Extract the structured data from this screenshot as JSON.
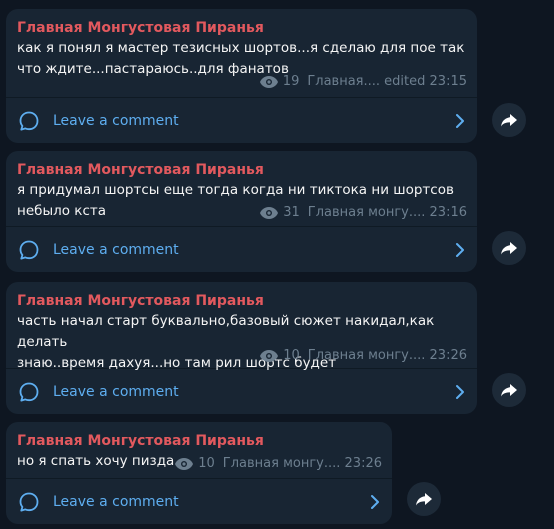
{
  "messages": [
    {
      "author": "Главная Монгустовая Пиранья",
      "text": "как я понял я мастер тезисных шортов...я сделаю для пое так\nчто ждите...пастараюсь..для фанатов",
      "views": "19",
      "signature": "Главная....",
      "edited": "edited",
      "time": "23:15",
      "comment_label": "Leave a comment"
    },
    {
      "author": "Главная Монгустовая Пиранья",
      "text": "я придумал шортсы еще тогда когда ни тиктока ни шортсов\nнебыло кста",
      "views": "31",
      "signature": "Главная монгу....",
      "edited": "",
      "time": "23:16",
      "comment_label": "Leave a comment"
    },
    {
      "author": "Главная Монгустовая Пиранья",
      "text": "часть начал старт буквально,базовый сюжет накидал,как делать\nзнаю..время дахуя...но там рил шортс будет",
      "views": "10",
      "signature": "Главная монгу....",
      "edited": "",
      "time": "23:26",
      "comment_label": "Leave a comment"
    },
    {
      "author": "Главная Монгустовая Пиранья",
      "text": "но я спать хочу пизда",
      "views": "10",
      "signature": "Главная монгу....",
      "edited": "",
      "time": "23:26",
      "comment_label": "Leave a comment"
    }
  ],
  "colors": {
    "background": "#0e1621",
    "bubble": "#182533",
    "author": "#e2595e",
    "link": "#5eaef0",
    "meta": "#6d7f8f"
  },
  "icons": {
    "views": "eye-icon",
    "comment": "comment-bubble-icon",
    "open": "chevron-right-icon",
    "share": "share-arrow-icon"
  }
}
